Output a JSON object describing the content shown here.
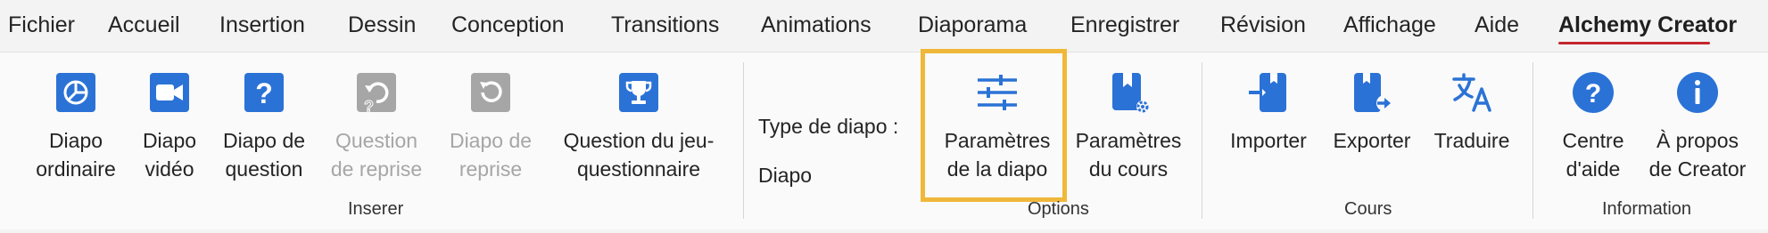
{
  "menu": {
    "tabs": [
      {
        "label": "Fichier"
      },
      {
        "label": "Accueil"
      },
      {
        "label": "Insertion"
      },
      {
        "label": "Dessin"
      },
      {
        "label": "Conception"
      },
      {
        "label": "Transitions"
      },
      {
        "label": "Animations"
      },
      {
        "label": "Diaporama"
      },
      {
        "label": "Enregistrer"
      },
      {
        "label": "Révision"
      },
      {
        "label": "Affichage"
      },
      {
        "label": "Aide"
      },
      {
        "label": "Alchemy Creator"
      }
    ],
    "active_tab": "Alchemy Creator"
  },
  "ribbon": {
    "inserer": {
      "group_label": "Inserer",
      "commands": [
        {
          "label": "Diapo\nordinaire",
          "icon": "pie-chart-icon",
          "enabled": true
        },
        {
          "label": "Diapo\nvidéo",
          "icon": "video-camera-icon",
          "enabled": true
        },
        {
          "label": "Diapo de\nquestion",
          "icon": "question-icon",
          "enabled": true
        },
        {
          "label": "Question\nde reprise",
          "icon": "question-retry-icon",
          "enabled": false
        },
        {
          "label": "Diapo de\nreprise",
          "icon": "retry-icon",
          "enabled": false
        },
        {
          "label": "Question du jeu-\nquestionnaire",
          "icon": "trophy-icon",
          "enabled": true
        }
      ]
    },
    "options": {
      "group_label": "Options",
      "slide_type_label": "Type de diapo :",
      "slide_type_value": "Diapo",
      "commands": [
        {
          "label": "Paramètres\nde la diapo",
          "icon": "sliders-icon",
          "highlighted": true
        },
        {
          "label": "Paramètres\ndu cours",
          "icon": "bookmark-gear-icon"
        }
      ]
    },
    "cours": {
      "group_label": "Cours",
      "commands": [
        {
          "label": "Importer",
          "icon": "import-icon"
        },
        {
          "label": "Exporter",
          "icon": "export-icon"
        },
        {
          "label": "Traduire",
          "icon": "translate-icon"
        }
      ]
    },
    "information": {
      "group_label": "Information",
      "commands": [
        {
          "label": "Centre\nd'aide",
          "icon": "help-circle-icon"
        },
        {
          "label": "À propos\nde Creator",
          "icon": "info-circle-icon"
        }
      ]
    }
  },
  "colors": {
    "accent_blue": "#2b72d6",
    "disabled_gray": "#a6a6a6",
    "highlight_yellow": "#f0b83a",
    "active_underline": "#c4262e"
  }
}
